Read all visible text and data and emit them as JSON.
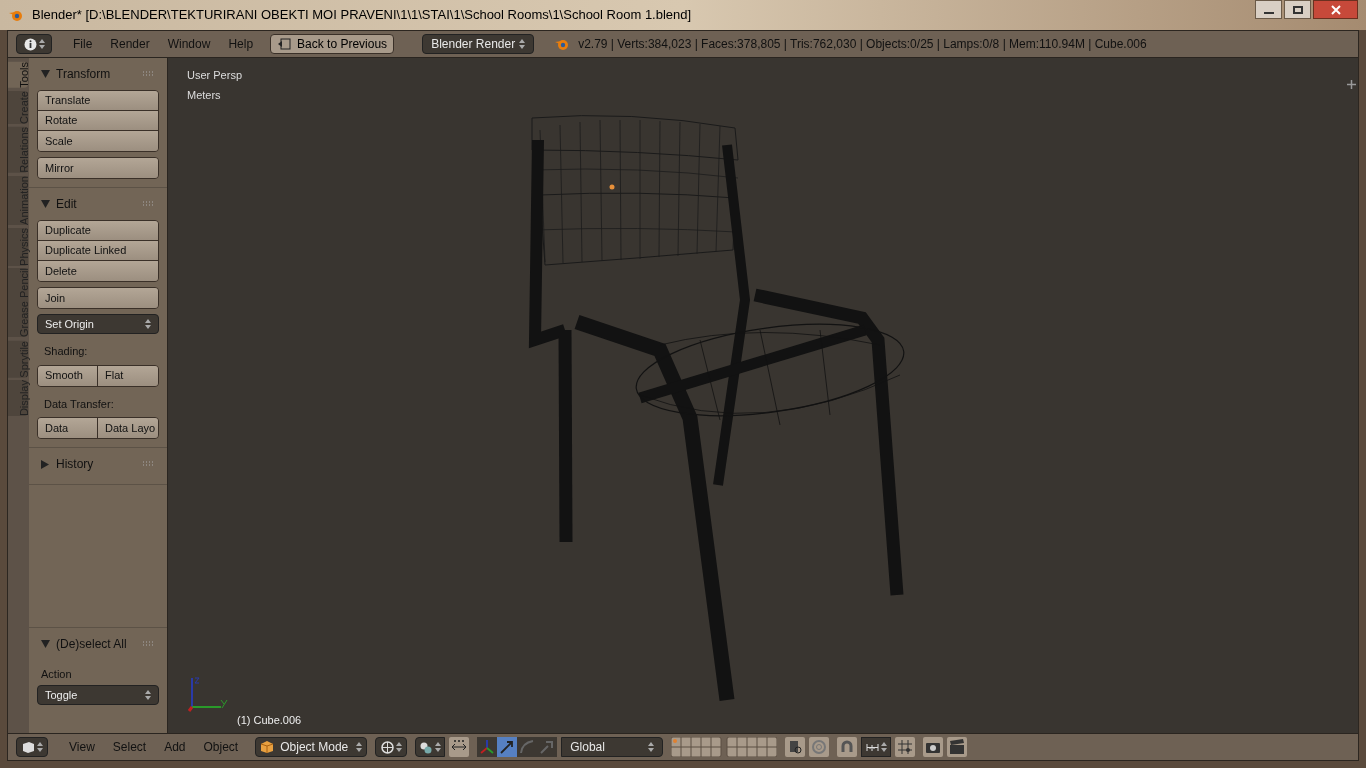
{
  "window": {
    "title": "Blender* [D:\\BLENDER\\TEKTURIRANI OBEKTI MOI PRAVENI\\1\\1\\STAI\\1\\School Rooms\\1\\School Room 1.blend]"
  },
  "header": {
    "menus": [
      "File",
      "Render",
      "Window",
      "Help"
    ],
    "back_button": "Back to Previous",
    "engine": "Blender Render",
    "stats": "v2.79 | Verts:384,023 | Faces:378,805 | Tris:762,030 | Objects:0/25 | Lamps:0/8 | Mem:110.94M | Cube.006"
  },
  "tool_tabs": [
    {
      "label": "Tools",
      "selected": true
    },
    {
      "label": "Create",
      "selected": false
    },
    {
      "label": "Relations",
      "selected": false
    },
    {
      "label": "Animation",
      "selected": false
    },
    {
      "label": "Physics",
      "selected": false
    },
    {
      "label": "Grease Pencil",
      "selected": false
    },
    {
      "label": "Sprytile",
      "selected": false
    },
    {
      "label": "Display",
      "selected": false
    }
  ],
  "sections": [
    {
      "title": "Transform",
      "expanded": true,
      "items": [
        {
          "kind": "stack",
          "buttons": [
            "Translate",
            "Rotate",
            "Scale"
          ]
        },
        {
          "kind": "stack",
          "buttons": [
            "Mirror"
          ]
        }
      ]
    },
    {
      "title": "Edit",
      "expanded": true,
      "items": [
        {
          "kind": "stack",
          "buttons": [
            "Duplicate",
            "Duplicate Linked",
            "Delete"
          ]
        },
        {
          "kind": "stack",
          "buttons": [
            "Join"
          ]
        },
        {
          "kind": "dropdown",
          "value": "Set Origin"
        },
        {
          "kind": "label",
          "text": "Shading:"
        },
        {
          "kind": "row",
          "buttons": [
            "Smooth",
            "Flat"
          ]
        },
        {
          "kind": "label",
          "text": "Data Transfer:"
        },
        {
          "kind": "row",
          "buttons": [
            "Data",
            "Data Layo"
          ]
        }
      ]
    },
    {
      "title": "History",
      "expanded": false
    }
  ],
  "operator_panel": {
    "title": "(De)select All",
    "expanded": true,
    "label": "Action",
    "value": "Toggle"
  },
  "viewport": {
    "view_name": "User Persp",
    "units": "Meters",
    "object_label": "(1) Cube.006"
  },
  "footer": {
    "menus": [
      "View",
      "Select",
      "Add",
      "Object"
    ],
    "mode": "Object Mode",
    "manipulators": [
      {
        "kind": "axes",
        "selected": false
      },
      {
        "kind": "translate",
        "selected": true
      },
      {
        "kind": "rotate",
        "selected": false
      },
      {
        "kind": "scale",
        "selected": false
      }
    ],
    "orientation": "Global"
  }
}
